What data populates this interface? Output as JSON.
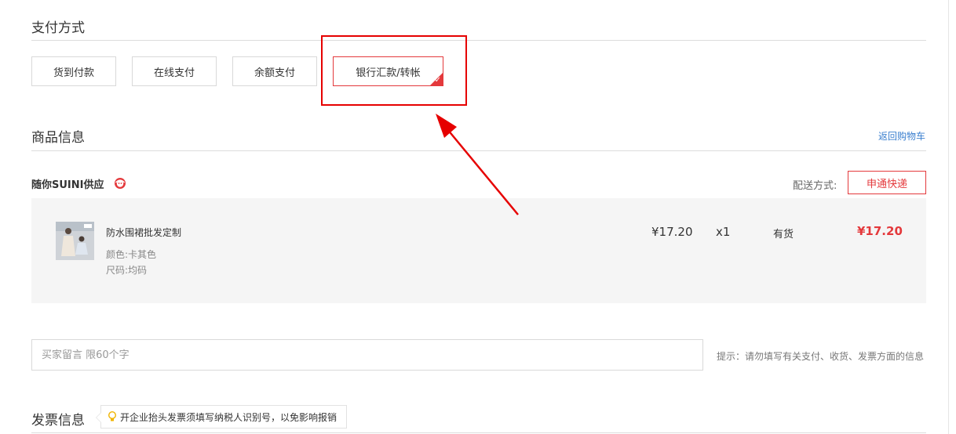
{
  "payment": {
    "title": "支付方式",
    "options": [
      {
        "label": "货到付款"
      },
      {
        "label": "在线支付"
      },
      {
        "label": "余额支付"
      },
      {
        "label": "银行汇款/转帐"
      }
    ],
    "selected": "银行汇款/转帐"
  },
  "goods": {
    "title": "商品信息",
    "back_link": "返回购物车",
    "supplier": "随你SUINI供应",
    "shipping_label": "配送方式:",
    "shipping_value": "申通快递",
    "item": {
      "name": "防水围裙批发定制",
      "color": "颜色:卡其色",
      "size": "尺码:均码",
      "price": "¥17.20",
      "qty": "x1",
      "stock": "有货",
      "subtotal": "¥17.20"
    }
  },
  "memo": {
    "placeholder": "买家留言 限60个字",
    "hint": "提示：请勿填写有关支付、收货、发票方面的信息"
  },
  "invoice": {
    "title": "发票信息",
    "tooltip": "开企业抬头发票须填写纳税人识别号，以免影响报销"
  },
  "colors": {
    "accent": "#e4393c",
    "annotation": "#e60000",
    "link": "#3a7fcf"
  }
}
